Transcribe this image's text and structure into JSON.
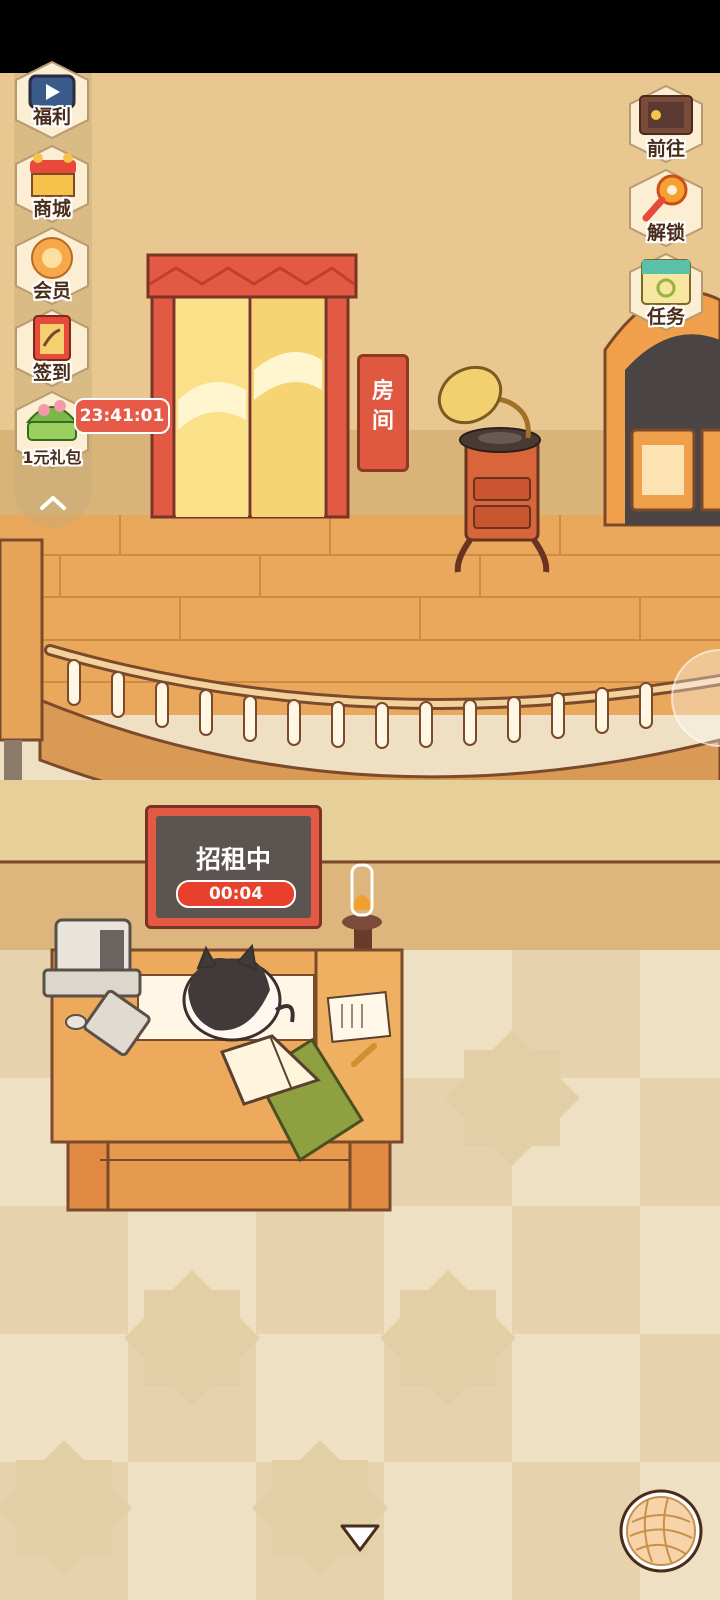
{
  "colors": {
    "wall": "#e8c890",
    "floor_wood": "#e8a85a",
    "tile_light": "#efe0c4",
    "tile_dark": "#e6d3ae",
    "accent_red": "#e35a44",
    "outline": "#7a4a2a"
  },
  "left_menu": {
    "items": [
      {
        "label": "福利",
        "icon": "tv-icon"
      },
      {
        "label": "商城",
        "icon": "shop-icon"
      },
      {
        "label": "会员",
        "icon": "flower-badge-icon"
      },
      {
        "label": "签到",
        "icon": "calendar-icon"
      },
      {
        "label": "1元礼包",
        "icon": "gift-basket-icon"
      }
    ],
    "gift_timer": "23:41:01",
    "collapse_icon": "chevron-up-icon"
  },
  "right_menu": {
    "items": [
      {
        "label": "前往",
        "icon": "signboard-icon"
      },
      {
        "label": "解锁",
        "icon": "key-icon"
      },
      {
        "label": "任务",
        "icon": "task-scroll-icon"
      }
    ]
  },
  "room_sign": {
    "text": [
      "房",
      "间"
    ]
  },
  "rent_panel": {
    "title": "招租中",
    "timer": "00:04"
  },
  "bottom": {
    "down_icon": "triangle-down-icon",
    "yarn_icon": "yarn-ball-icon"
  }
}
